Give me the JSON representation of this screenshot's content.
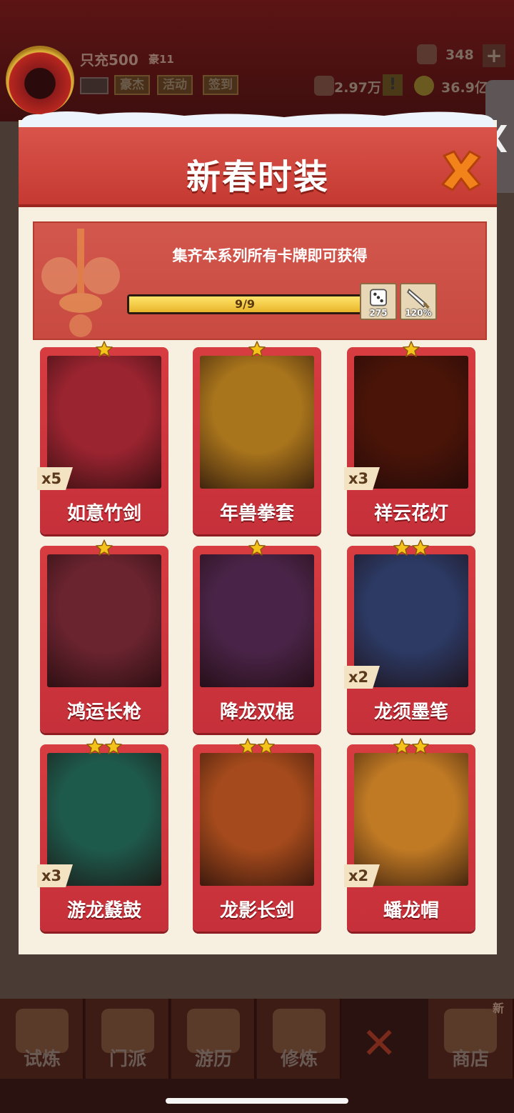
{
  "hud": {
    "player_name": "只充500",
    "vip_label": "豪11",
    "buttons": [
      "豪杰",
      "活动",
      "签到"
    ],
    "gems": "348",
    "silver": "2.97万",
    "gold": "36.9亿"
  },
  "dialog": {
    "title": "新春时装",
    "banner_text": "集齐本系列所有卡牌即可获得",
    "progress_text": "9/9",
    "progress_fraction": 1.0,
    "rewards": [
      {
        "icon": "dice-icon",
        "value": "275"
      },
      {
        "icon": "sword-icon",
        "value": "120%"
      }
    ]
  },
  "cards": [
    {
      "name": "如意竹剑",
      "stars": 1,
      "count": "x5",
      "color": "#9a2430"
    },
    {
      "name": "年兽拳套",
      "stars": 1,
      "count": "",
      "color": "#a8741c"
    },
    {
      "name": "祥云花灯",
      "stars": 1,
      "count": "x3",
      "color": "#4a1408"
    },
    {
      "name": "鸿运长枪",
      "stars": 1,
      "count": "",
      "color": "#6a2430"
    },
    {
      "name": "降龙双棍",
      "stars": 1,
      "count": "",
      "color": "#4a2448"
    },
    {
      "name": "龙须墨笔",
      "stars": 2,
      "count": "x2",
      "color": "#2c3a64"
    },
    {
      "name": "游龙鼗鼓",
      "stars": 2,
      "count": "x3",
      "color": "#1e5a4c"
    },
    {
      "name": "龙影长剑",
      "stars": 2,
      "count": "",
      "color": "#a44a1c"
    },
    {
      "name": "蟠龙帽",
      "stars": 2,
      "count": "x2",
      "color": "#c07a24"
    }
  ],
  "bottom_nav": {
    "items": [
      "试炼",
      "门派",
      "游历",
      "修炼",
      "商店"
    ],
    "new_badge": "新"
  },
  "colors": {
    "header_red": "#d24a42",
    "card_red": "#d2383e",
    "panel_cream": "#f7efdf",
    "star_gold": "#f5c21a"
  }
}
